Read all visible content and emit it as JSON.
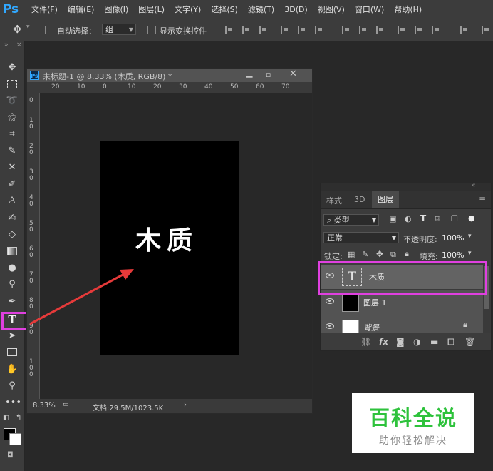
{
  "app": {
    "logo": "Ps",
    "menus": [
      "文件(F)",
      "编辑(E)",
      "图像(I)",
      "图层(L)",
      "文字(Y)",
      "选择(S)",
      "滤镜(T)",
      "3D(D)",
      "视图(V)",
      "窗口(W)",
      "帮助(H)"
    ]
  },
  "options": {
    "auto_select_label": "自动选择：",
    "auto_select_value": "组",
    "show_transform_label": "显示变换控件"
  },
  "toolbar": {
    "tools": [
      "move-tool-icon",
      "marquee-tool-icon",
      "lasso-tool-icon",
      "magic-wand-icon",
      "crop-tool-icon",
      "eyedropper-icon",
      "healing-brush-icon",
      "brush-tool-icon",
      "clone-stamp-icon",
      "history-brush-icon",
      "eraser-icon",
      "gradient-icon",
      "blur-icon",
      "dodge-icon",
      "pen-icon",
      "type-tool-icon",
      "path-select-icon",
      "rectangle-icon",
      "hand-icon",
      "zoom-icon",
      "more-tools-icon"
    ],
    "text_tool_glyph": "T"
  },
  "document": {
    "title": "未标题-1 @ 8.33% (木质, RGB/8) *",
    "ruler_h": [
      "20",
      "10",
      "0",
      "10",
      "20",
      "30",
      "40",
      "50",
      "60",
      "70"
    ],
    "ruler_v": [
      "0",
      "10",
      "20",
      "30",
      "40",
      "50",
      "60",
      "70",
      "80",
      "90",
      "100"
    ],
    "canvas_text": "木质",
    "zoom": "8.33%",
    "doc_size": "文档:29.5M/1023.5K",
    "status_arrow": "›"
  },
  "layers_panel": {
    "tabs": [
      "样式",
      "3D",
      "图层"
    ],
    "active_tab": "图层",
    "filter_label": "类型",
    "blend_mode": "正常",
    "opacity_label": "不透明度:",
    "opacity_value": "100%",
    "lock_label": "锁定:",
    "fill_label": "填充:",
    "fill_value": "100%",
    "layers": [
      {
        "name": "木质",
        "type": "text",
        "thumb_glyph": "T"
      },
      {
        "name": "图层 1",
        "type": "pixel"
      },
      {
        "name": "背景",
        "type": "background"
      }
    ],
    "footer_icons": [
      "link-icon",
      "fx-icon",
      "mask-icon",
      "adjustment-icon",
      "folder-icon",
      "new-layer-icon",
      "trash-icon"
    ],
    "footer_fx": "fx"
  },
  "watermark": {
    "title": "百科全说",
    "subtitle": "助你轻松解决"
  },
  "colors": {
    "highlight": "#e040e0",
    "arrow": "#e63a3a",
    "watermark_green": "#2ec23c"
  }
}
